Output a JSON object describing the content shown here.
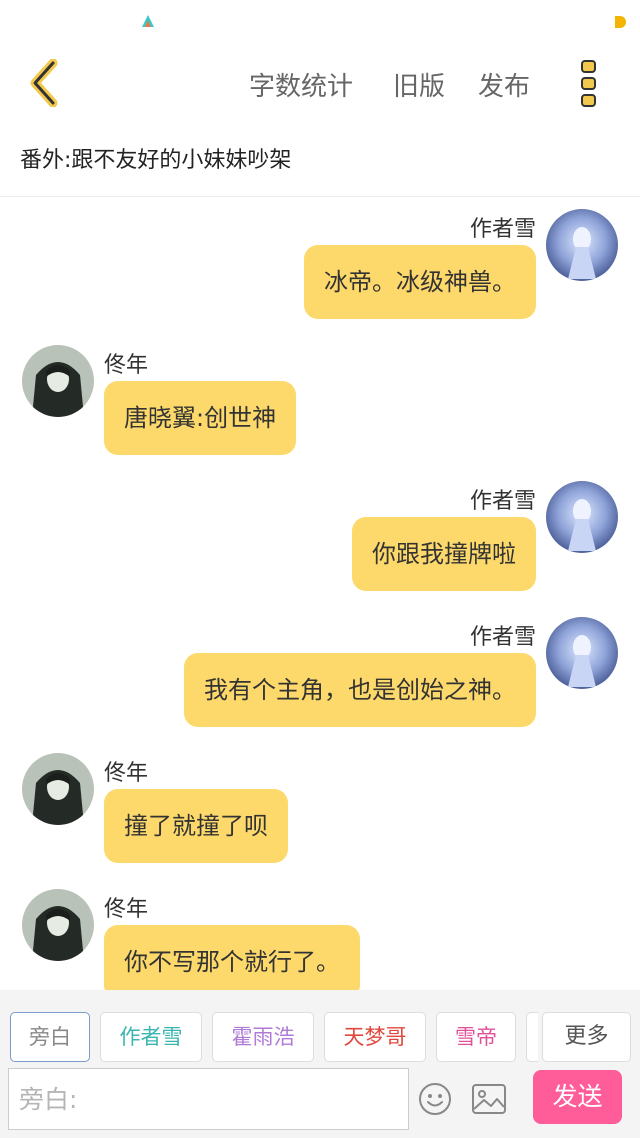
{
  "header": {
    "actions": [
      "字数统计",
      "旧版",
      "发布"
    ]
  },
  "chapter_title": "番外:跟不友好的小妹妹吵架",
  "messages": [
    {
      "side": "right",
      "name": "作者雪",
      "text": "冰帝。冰级神兽。"
    },
    {
      "side": "left",
      "name": "佟年",
      "text": "唐晓翼:创世神"
    },
    {
      "side": "right",
      "name": "作者雪",
      "text": "你跟我撞牌啦"
    },
    {
      "side": "right",
      "name": "作者雪",
      "text": "我有个主角，也是创始之神。"
    },
    {
      "side": "left",
      "name": "佟年",
      "text": "撞了就撞了呗"
    },
    {
      "side": "left",
      "name": "佟年",
      "text": "你不写那个就行了。"
    }
  ],
  "roles": [
    {
      "label": "旁白",
      "color": "#888888"
    },
    {
      "label": "作者雪",
      "color": "#3bb5b0"
    },
    {
      "label": "霍雨浩",
      "color": "#b07bd6"
    },
    {
      "label": "天梦哥",
      "color": "#e0483d"
    },
    {
      "label": "雪帝",
      "color": "#e0519a"
    }
  ],
  "more_roles_label": "更多",
  "composer": {
    "placeholder": "旁白:",
    "value": "",
    "send_label": "发送"
  },
  "colors": {
    "bubble": "#fdd96b",
    "send": "#fe5d99",
    "accent": "#f2c94c"
  },
  "icons": {
    "back": "chevron-left-icon",
    "more": "more-vertical-icon",
    "emoji": "smiley-icon",
    "image": "image-icon"
  }
}
